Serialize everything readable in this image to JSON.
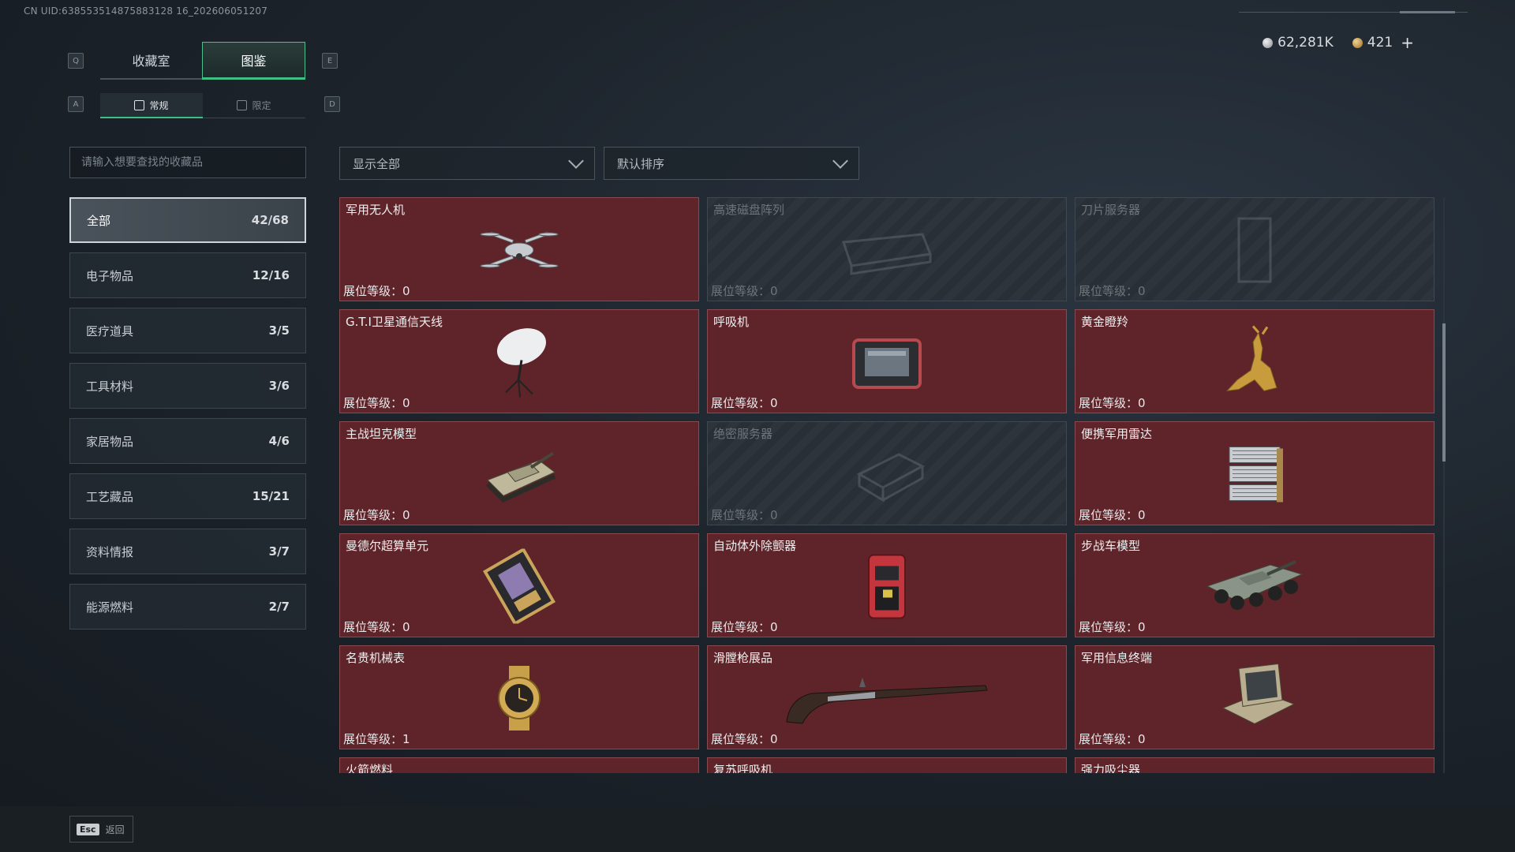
{
  "header": {
    "uid": "CN UID:638553514875883128 16_202606051207",
    "currency": [
      {
        "icon": "silver-coin-icon",
        "value": "62,281K"
      },
      {
        "icon": "gold-coin-icon",
        "value": "421"
      }
    ],
    "plus": "+"
  },
  "keys": {
    "q": "Q",
    "e": "E",
    "a": "A",
    "d": "D"
  },
  "tabs": [
    {
      "label": "收藏室",
      "active": false
    },
    {
      "label": "图鉴",
      "active": true
    }
  ],
  "subtabs": [
    {
      "label": "常规",
      "active": true
    },
    {
      "label": "限定",
      "active": false
    }
  ],
  "search": {
    "placeholder": "请输入想要查找的收藏品"
  },
  "filters": {
    "show": "显示全部",
    "sort": "默认排序"
  },
  "categories": [
    {
      "label": "全部",
      "count": "42/68",
      "active": true
    },
    {
      "label": "电子物品",
      "count": "12/16"
    },
    {
      "label": "医疗道具",
      "count": "3/5"
    },
    {
      "label": "工具材料",
      "count": "3/6"
    },
    {
      "label": "家居物品",
      "count": "4/6"
    },
    {
      "label": "工艺藏品",
      "count": "15/21"
    },
    {
      "label": "资料情报",
      "count": "3/7"
    },
    {
      "label": "能源燃料",
      "count": "2/7"
    }
  ],
  "level_label": "展位等级：",
  "items": [
    {
      "name": "军用无人机",
      "level": "0",
      "locked": false,
      "icon": "drone-icon"
    },
    {
      "name": "高速磁盘阵列",
      "level": "0",
      "locked": true,
      "icon": "disk-array-icon"
    },
    {
      "name": "刀片服务器",
      "level": "0",
      "locked": true,
      "icon": "blade-server-icon"
    },
    {
      "name": "G.T.I卫星通信天线",
      "level": "0",
      "locked": false,
      "icon": "satellite-dish-icon"
    },
    {
      "name": "呼吸机",
      "level": "0",
      "locked": false,
      "icon": "ventilator-icon"
    },
    {
      "name": "黄金瞪羚",
      "level": "0",
      "locked": false,
      "icon": "golden-gazelle-icon"
    },
    {
      "name": "主战坦克模型",
      "level": "0",
      "locked": false,
      "icon": "tank-icon"
    },
    {
      "name": "绝密服务器",
      "level": "0",
      "locked": true,
      "icon": "secret-server-icon"
    },
    {
      "name": "便携军用雷达",
      "level": "0",
      "locked": false,
      "icon": "radar-icon"
    },
    {
      "name": "曼德尔超算单元",
      "level": "0",
      "locked": false,
      "icon": "supercomputer-unit-icon"
    },
    {
      "name": "自动体外除颤器",
      "level": "0",
      "locked": false,
      "icon": "defibrillator-icon"
    },
    {
      "name": "步战车模型",
      "level": "0",
      "locked": false,
      "icon": "ifv-icon"
    },
    {
      "name": "名贵机械表",
      "level": "1",
      "locked": false,
      "icon": "watch-icon"
    },
    {
      "name": "滑膛枪展品",
      "level": "0",
      "locked": false,
      "icon": "musket-icon"
    },
    {
      "name": "军用信息终端",
      "level": "0",
      "locked": false,
      "icon": "terminal-icon"
    },
    {
      "name": "火箭燃料",
      "level": "",
      "locked": false,
      "icon": "rocket-fuel-icon"
    },
    {
      "name": "复苏呼吸机",
      "level": "",
      "locked": false,
      "icon": "resuscitator-icon"
    },
    {
      "name": "强力吸尘器",
      "level": "",
      "locked": false,
      "icon": "vacuum-icon"
    }
  ],
  "footer": {
    "key": "Esc",
    "label": "返回"
  }
}
